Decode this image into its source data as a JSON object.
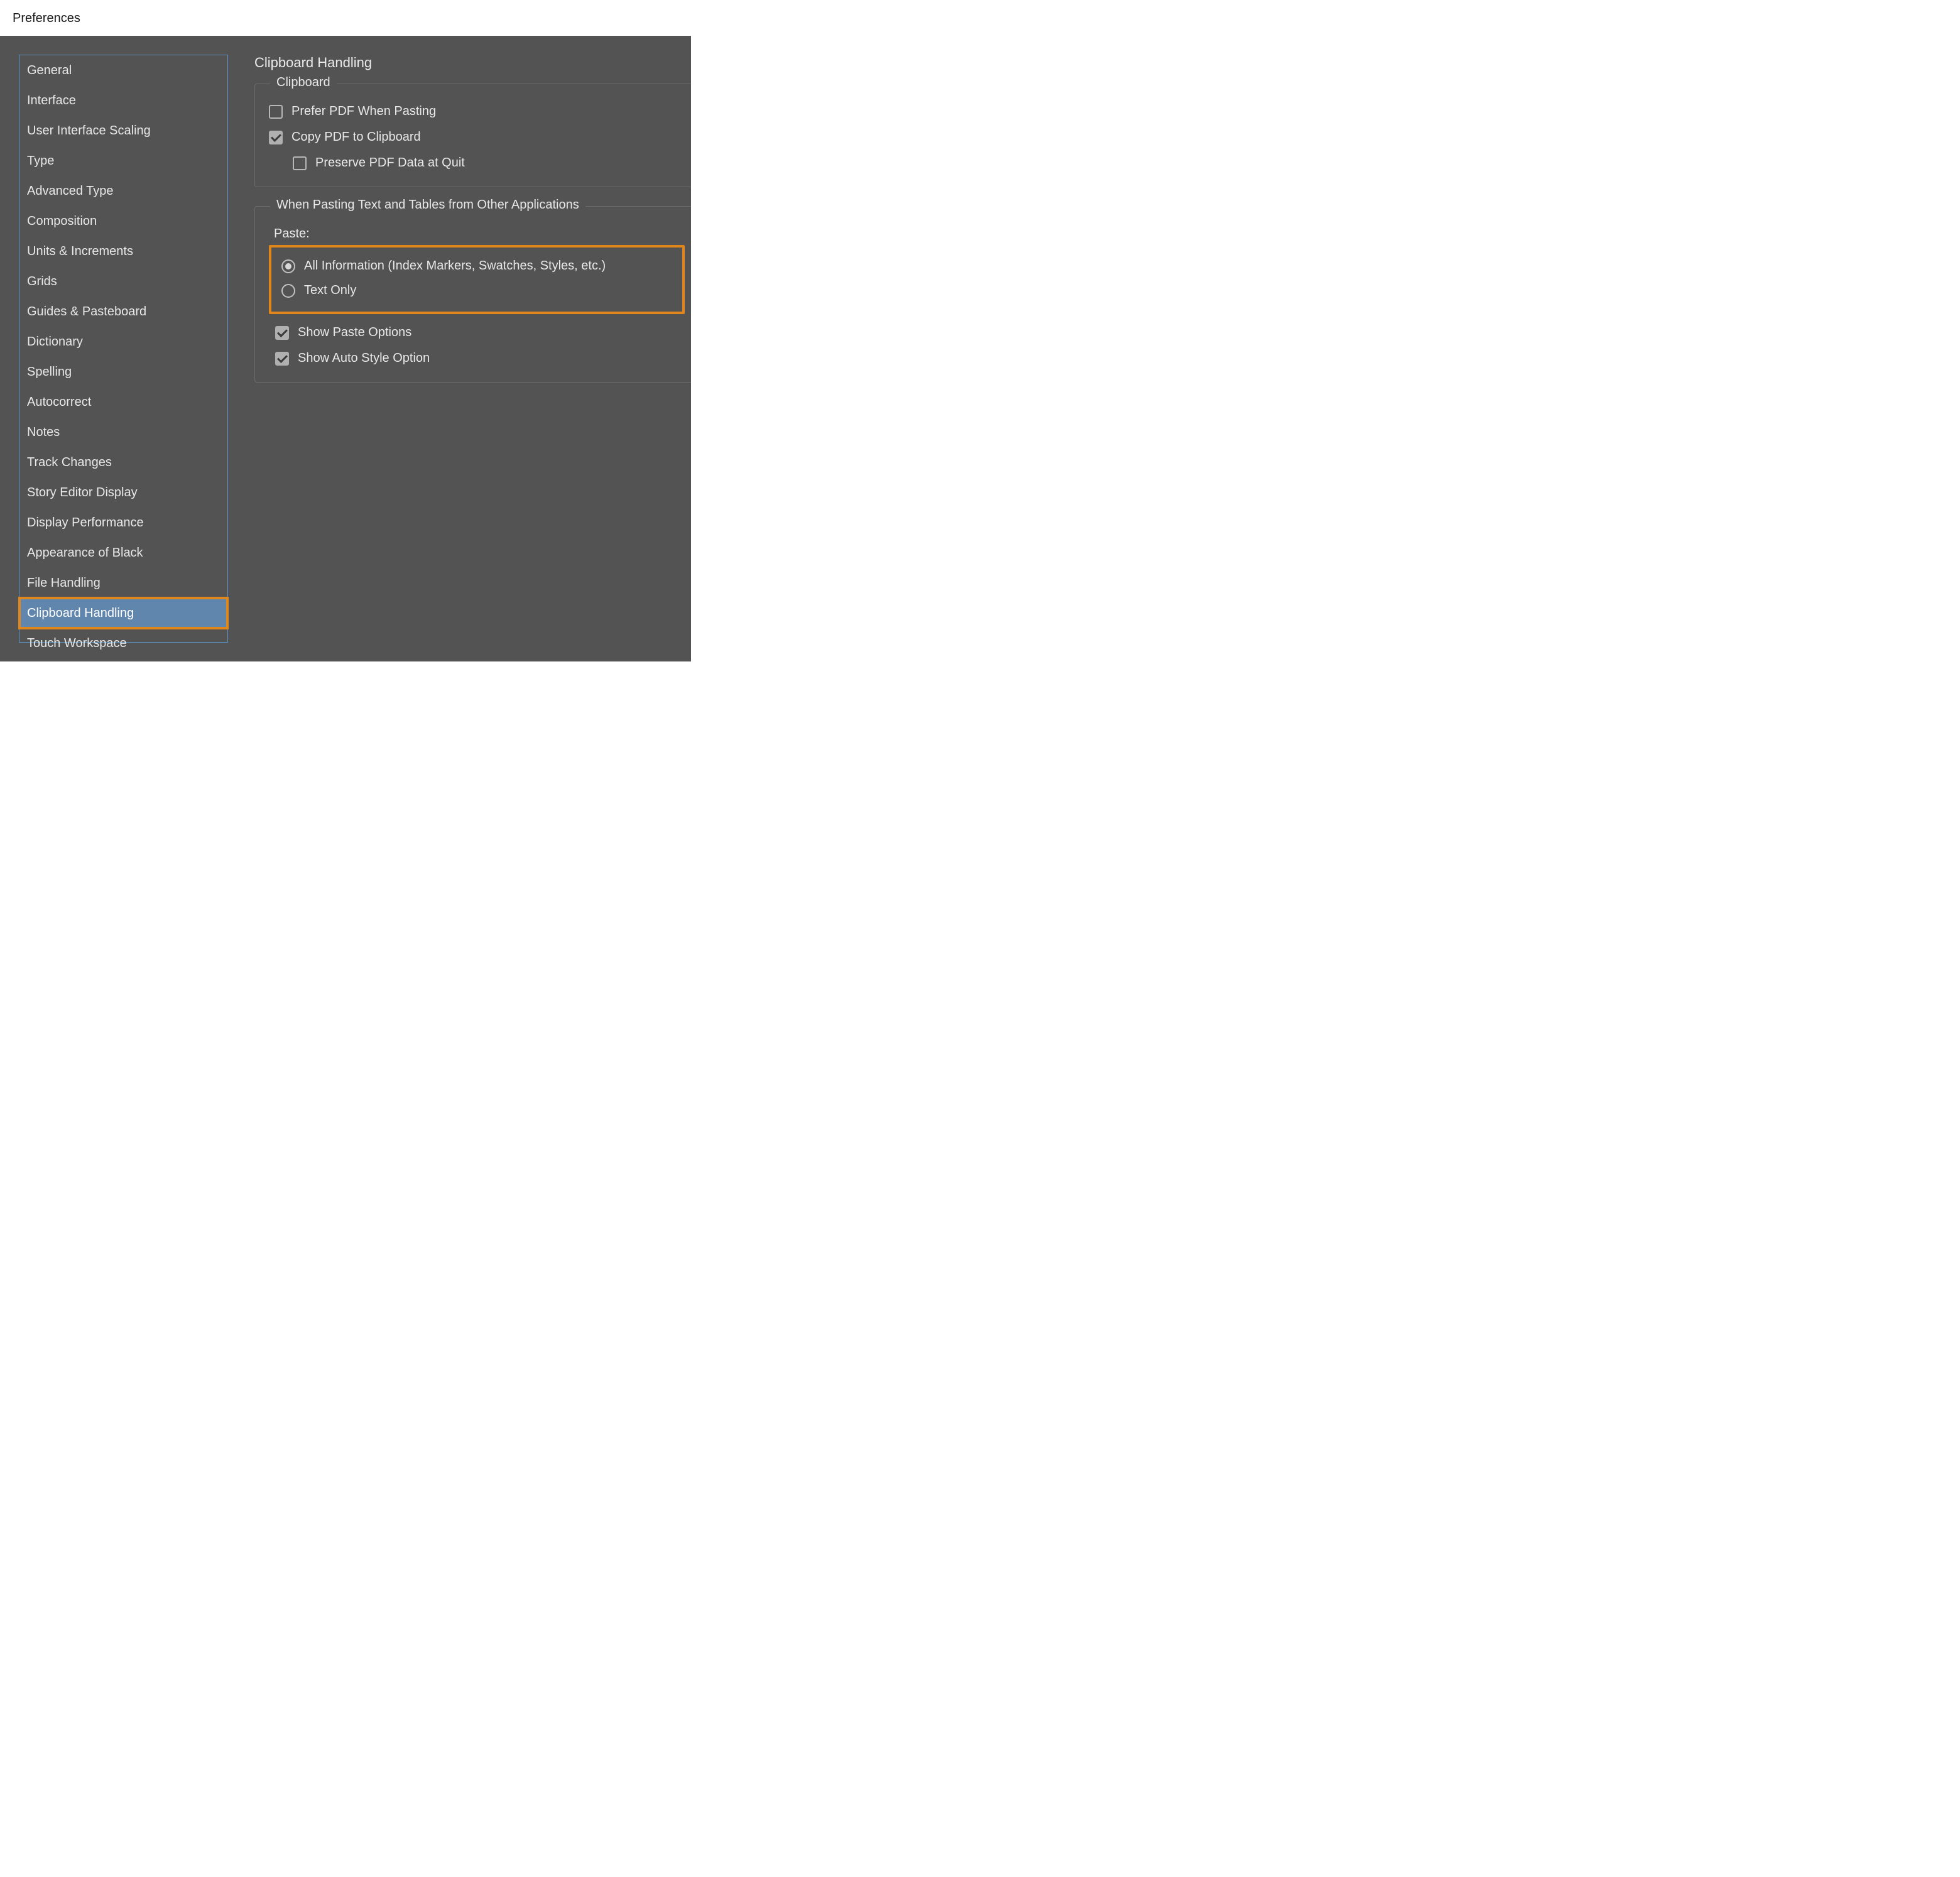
{
  "window": {
    "title": "Preferences"
  },
  "sidebar": {
    "items": [
      "General",
      "Interface",
      "User Interface Scaling",
      "Type",
      "Advanced Type",
      "Composition",
      "Units & Increments",
      "Grids",
      "Guides & Pasteboard",
      "Dictionary",
      "Spelling",
      "Autocorrect",
      "Notes",
      "Track Changes",
      "Story Editor Display",
      "Display Performance",
      "Appearance of Black",
      "File Handling",
      "Clipboard Handling",
      "Touch Workspace"
    ],
    "selected_index": 18
  },
  "content": {
    "title": "Clipboard Handling",
    "clipboard": {
      "legend": "Clipboard",
      "prefer_pdf": {
        "label": "Prefer PDF When Pasting",
        "checked": false
      },
      "copy_pdf": {
        "label": "Copy PDF to Clipboard",
        "checked": true
      },
      "preserve_pdf": {
        "label": "Preserve PDF Data at Quit",
        "checked": false
      }
    },
    "pasting": {
      "legend": "When Pasting Text and Tables from Other Applications",
      "paste_label": "Paste:",
      "options": {
        "all_info": "All Information (Index Markers, Swatches, Styles, etc.)",
        "text_only": "Text Only"
      },
      "selected": "all_info",
      "show_paste_options": {
        "label": "Show Paste Options",
        "checked": true
      },
      "show_auto_style": {
        "label": "Show Auto Style Option",
        "checked": true
      }
    }
  }
}
